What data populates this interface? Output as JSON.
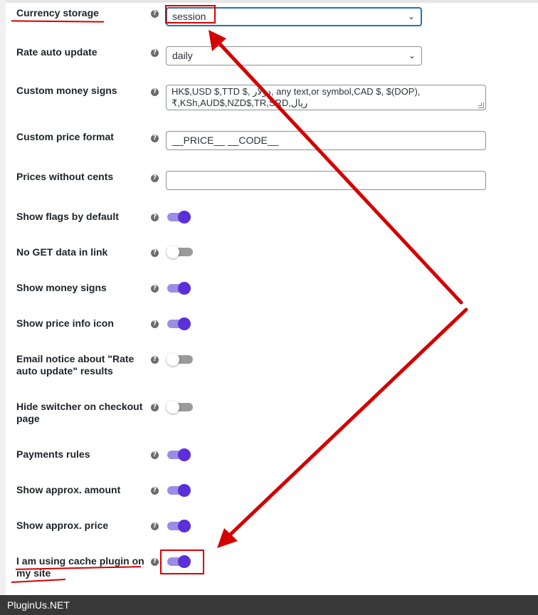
{
  "settings": {
    "currency_storage": {
      "label": "Currency storage",
      "value": "session",
      "help": "?"
    },
    "rate_auto_update": {
      "label": "Rate auto update",
      "value": "daily",
      "help": "?"
    },
    "custom_money_signs": {
      "label": "Custom money signs",
      "value": "HK$,USD $,TTD $, دولار, any text,or symbol,CAD $, $(DOP), ₹,KSh,AUD$,NZD$,TR,SRD,ريال",
      "help": "?"
    },
    "custom_price_format": {
      "label": "Custom price format",
      "value": "__PRICE__ __CODE__",
      "help": "?"
    },
    "prices_without_cents": {
      "label": "Prices without cents",
      "value": "",
      "help": "?"
    },
    "show_flags_by_default": {
      "label": "Show flags by default",
      "enabled": true,
      "help": "?"
    },
    "no_get_data_in_link": {
      "label": "No GET data in link",
      "enabled": false,
      "help": "?"
    },
    "show_money_signs": {
      "label": "Show money signs",
      "enabled": true,
      "help": "?"
    },
    "show_price_info_icon": {
      "label": "Show price info icon",
      "enabled": true,
      "help": "?"
    },
    "email_notice_rate_update": {
      "label": "Email notice about \"Rate auto update\" results",
      "enabled": false,
      "help": "?"
    },
    "hide_switcher_on_checkout": {
      "label": "Hide switcher on checkout page",
      "enabled": false,
      "help": "?"
    },
    "payments_rules": {
      "label": "Payments rules",
      "enabled": true,
      "help": "?"
    },
    "show_approx_amount": {
      "label": "Show approx. amount",
      "enabled": true,
      "help": "?"
    },
    "show_approx_price": {
      "label": "Show approx. price",
      "enabled": true,
      "help": "?"
    },
    "using_cache_plugin": {
      "label": "I am using cache plugin on my site",
      "enabled": true,
      "help": "?"
    }
  },
  "footer": {
    "brand": "PluginUs.NET"
  },
  "icons": {
    "help": "question-circle-icon",
    "select_arrow": "chevron-down-icon"
  },
  "colors": {
    "toggle_on": "#5b2fd9",
    "toggle_track_on": "#9a8de6",
    "annotation": "#d40000",
    "focus": "#2271b1",
    "footer_bg": "#383838"
  }
}
